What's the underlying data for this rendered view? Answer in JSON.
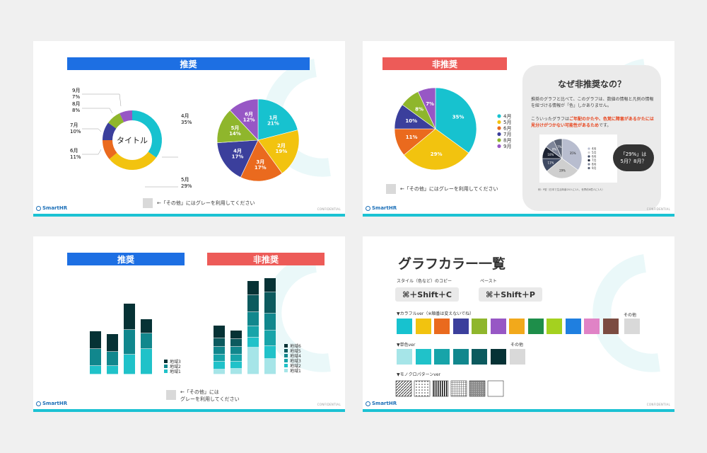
{
  "brand": {
    "logo_text": "SmartHR",
    "confidential": "CONFIDENTIAL"
  },
  "slide1": {
    "banner": "推奨",
    "donut_center": "タイトル",
    "note": "←「その他」にはグレーを利用してください",
    "donut_labels": [
      {
        "month": "4月",
        "pct": "35%"
      },
      {
        "month": "5月",
        "pct": "29%"
      },
      {
        "month": "6月",
        "pct": "11%"
      },
      {
        "month": "7月",
        "pct": "10%"
      },
      {
        "month": "8月",
        "pct": "8%"
      },
      {
        "month": "9月",
        "pct": "7%"
      }
    ],
    "pie_labels": [
      {
        "month": "1月",
        "pct": "21%"
      },
      {
        "month": "2月",
        "pct": "19%"
      },
      {
        "month": "3月",
        "pct": "17%"
      },
      {
        "month": "4月",
        "pct": "17%"
      },
      {
        "month": "5月",
        "pct": "14%"
      },
      {
        "month": "6月",
        "pct": "12%"
      }
    ]
  },
  "slide2": {
    "banner": "非推奨",
    "note": "←「その他」にはグレーを利用してください",
    "pie_pcts": [
      "35%",
      "29%",
      "11%",
      "10%",
      "8%",
      "7%"
    ],
    "legend": [
      "4月",
      "5月",
      "6月",
      "7月",
      "8月",
      "9月"
    ],
    "bubble_title": "なぜ非推奨なの？",
    "bubble_p1": "推奨のグラフと比べて、このグラフは、数値の情報と凡例の情報を紐づける情報が「色」しかありません。",
    "bubble_p2_a": "こういったグラフは",
    "bubble_p2_b": "ご年配のかたや、色覚に障害があるかたには見分けがつかない可能性があるため",
    "bubble_p2_c": "です。",
    "speech": "「29%」は\n5月？8月？",
    "mini_legend": [
      "4月",
      "5月",
      "6月",
      "7月",
      "8月",
      "9月"
    ],
    "mini_pcts": [
      "35%",
      "29%",
      "11%",
      "10%",
      "8%",
      "7%"
    ],
    "source_note": "例：P型（日本で生活年齢20人に1人、世界約8億人に1人）"
  },
  "slide3": {
    "banner_rec": "推奨",
    "banner_notrec": "非推奨",
    "note_line1": "←「その他」には",
    "note_line2": "グレーを利用してください",
    "legend_left": [
      "地域3",
      "地域2",
      "地域1"
    ],
    "legend_right": [
      "地域6",
      "地域5",
      "地域4",
      "地域3",
      "地域2",
      "地域1"
    ]
  },
  "slide4": {
    "title": "グラフカラー一覧",
    "copy_label": "スタイル（色など）のコピー",
    "paste_label": "ペースト",
    "copy_key": "⌘＋Shift＋C",
    "paste_key": "⌘＋Shift＋P",
    "colorful_label": "▼カラフルver（※順番は変えないでね）",
    "single_label": "▼単色ver",
    "mono_label": "▼モノクロパターンver",
    "other_label": "その他",
    "colorful_colors": [
      "#17c2cf",
      "#f2c30f",
      "#ea6a1e",
      "#3b3f9c",
      "#8fb62c",
      "#9757c5",
      "#f2a91b",
      "#1e8e4a",
      "#a4d11f",
      "#1f7fe0",
      "#e083c6",
      "#7b4b41"
    ],
    "single_colors": [
      "#a6e5e8",
      "#20c2c9",
      "#17a4a9",
      "#11878d",
      "#0c5a5e",
      "#063235"
    ],
    "gray": "#d9d9d9"
  }
}
